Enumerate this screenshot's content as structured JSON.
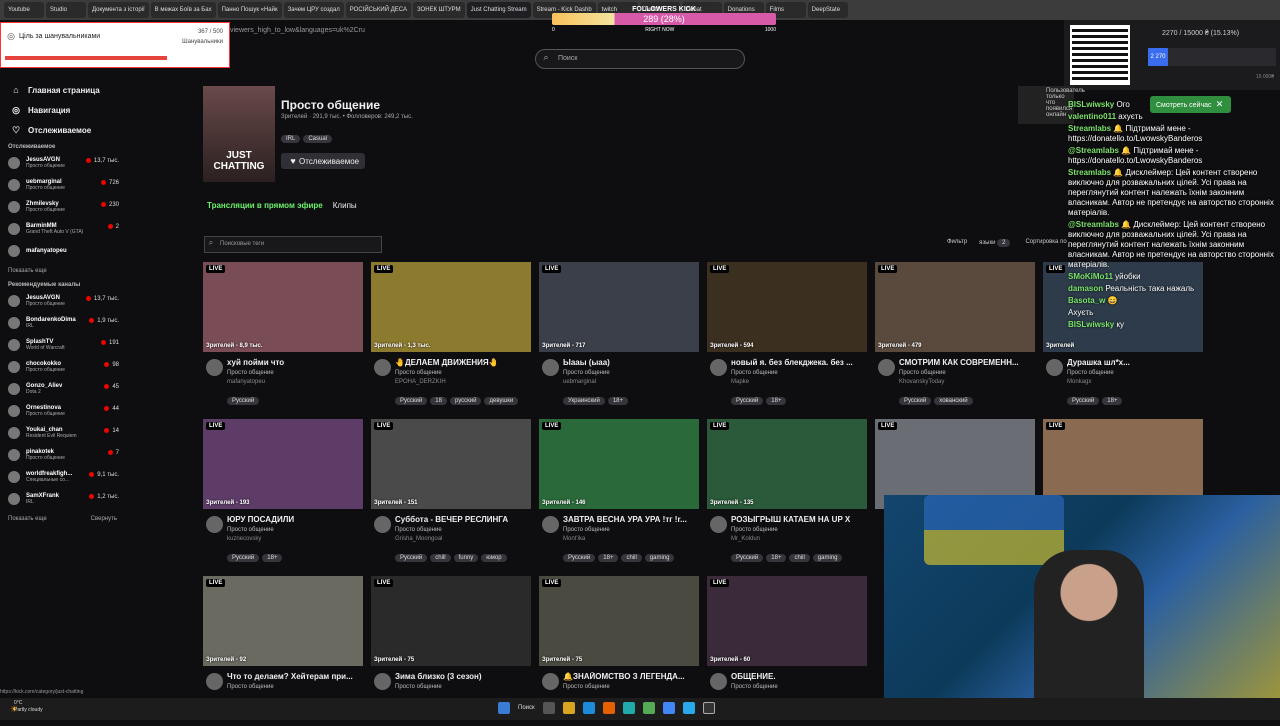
{
  "browser": {
    "tabs": [
      "Youtube",
      "Studio",
      "Документа з історії",
      "В межах Боїв за Бах",
      "Панно Пошук «Найк",
      "Зачем ЦРУ создал",
      "РОСІЙСЬКИЙ ДЕСА",
      "ЗОНЕК ШТУРМ",
      "Just Chatting Stream",
      "Stream - Kick Dashb",
      "twitch",
      "Twitch",
      "Donat",
      "Donations",
      "Films",
      "DeepState"
    ],
    "address": "viewers_high_to_low&languages=uk%2Cru"
  },
  "goal": {
    "title": "Ціль за шанувальниками",
    "count": "367 / 500",
    "sub": "Шанувальники"
  },
  "follower_bar": {
    "title": "FOLLOWERS KICK",
    "value": "289 (28%)",
    "progress_pct": 28,
    "min": "0",
    "mid": "RIGHT NOW",
    "max": "1000"
  },
  "search": {
    "placeholder": "Поиск"
  },
  "nav": [
    {
      "label": "Главная страница",
      "icon": "home-icon"
    },
    {
      "label": "Навигация",
      "icon": "compass-icon"
    },
    {
      "label": "Отслеживаемое",
      "icon": "heart-icon"
    }
  ],
  "followed": {
    "heading": "Отслеживаемое",
    "more": "Показать еще",
    "items": [
      {
        "name": "JesusAVGN",
        "game": "Просто общение",
        "viewers": "13,7 тыс."
      },
      {
        "name": "uebmarginal",
        "game": "Просто общение",
        "viewers": "726"
      },
      {
        "name": "Zhmilevsky",
        "game": "Просто общение",
        "viewers": "230"
      },
      {
        "name": "BarminMM",
        "game": "Grand Theft Auto V (GTA)",
        "viewers": "2"
      },
      {
        "name": "mafanyatopeu",
        "game": "",
        "viewers": ""
      }
    ]
  },
  "recommended": {
    "heading": "Рекомендуемые каналы",
    "more": "Показать еще",
    "collapse": "Свернуть",
    "items": [
      {
        "name": "JesusAVGN",
        "game": "Просто общение",
        "viewers": "13,7 тыс."
      },
      {
        "name": "BondarenkoDima",
        "game": "IRL",
        "viewers": "1,9 тыс."
      },
      {
        "name": "SplashTV",
        "game": "World of Warcraft",
        "viewers": "191"
      },
      {
        "name": "chocokokko",
        "game": "Просто общение",
        "viewers": "98"
      },
      {
        "name": "Gonzo_Aliev",
        "game": "Dota 2",
        "viewers": "45"
      },
      {
        "name": "Ornestinova",
        "game": "Просто общение",
        "viewers": "44"
      },
      {
        "name": "Youkai_chan",
        "game": "Resident Evil Requiem",
        "viewers": "14"
      },
      {
        "name": "pinakotek",
        "game": "Просто общение",
        "viewers": "7"
      },
      {
        "name": "worldfreakfigh...",
        "game": "Специальные со...",
        "viewers": "9,1 тыс."
      },
      {
        "name": "SamXFrank",
        "game": "IRL",
        "viewers": "1,2 тыс."
      }
    ]
  },
  "category": {
    "title": "Просто общение",
    "stats": "Зрителей · 291,9 тыс.  •  Фолловеров: 249,2 тыс.",
    "tags": [
      "IRL",
      "Casual"
    ],
    "follow_label": "Отслеживаемое",
    "cover_text": "JUST CHATTING"
  },
  "tabs": {
    "live": "Трансляции в прямом эфире",
    "clips": "Клипы"
  },
  "tag_search": {
    "placeholder": "Поисковые теги"
  },
  "filters": {
    "filter": "Фильтр",
    "languages": "языки",
    "lang_count": "2",
    "sort": "Сортировка по"
  },
  "streams": [
    {
      "title": "хуй пойми что",
      "channel": "mafanyatopeu",
      "cat": "Просто общение",
      "viewers": "Зрителей - 8,9 тыс.",
      "tags": [
        "Русский"
      ],
      "color": "#7a4c55"
    },
    {
      "title": "🤚ДЕЛАЕМ ДВИЖЕНИЯ🤚",
      "channel": "EPOHA_DERZKIH",
      "cat": "Просто общение",
      "viewers": "Зрителей - 1,3 тыс.",
      "tags": [
        "Русский",
        "18",
        "русский",
        "девушки"
      ],
      "color": "#8c7a2e"
    },
    {
      "title": "Ыааы (ыаа)",
      "channel": "uebmarginal",
      "cat": "Просто общение",
      "viewers": "Зрителей - 717",
      "tags": [
        "Украинский",
        "18+"
      ],
      "color": "#3a3f4a"
    },
    {
      "title": "новый я. без блекджека. без ...",
      "channel": "Mapke",
      "cat": "Просто общение",
      "viewers": "Зрителей - 594",
      "tags": [
        "Русский",
        "18+"
      ],
      "color": "#3b3020"
    },
    {
      "title": "СМОТРИМ КАК СОВРЕМЕНН...",
      "channel": "KhovanskyToday",
      "cat": "Просто общение",
      "viewers": "Зрителей - 479",
      "tags": [
        "Русский",
        "хованский"
      ],
      "color": "#5a4a3e"
    },
    {
      "title": "Дурашка шл*х...",
      "channel": "Monkagx",
      "cat": "Просто общение",
      "viewers": "Зрителей",
      "tags": [
        "Русский",
        "18+"
      ],
      "color": "#2d3b4a"
    },
    {
      "title": "ЮРУ ПОСАДИЛИ",
      "channel": "kuznecovsky",
      "cat": "Просто общение",
      "viewers": "Зрителей - 193",
      "tags": [
        "Русский",
        "18+"
      ],
      "color": "#5e3c68"
    },
    {
      "title": "Суббота - ВЕЧЕР РЕСЛИНГА",
      "channel": "Grisha_Moongoal",
      "cat": "Просто общение",
      "viewers": "Зрителей - 151",
      "tags": [
        "Русский",
        "chill",
        "funny",
        "юмор"
      ],
      "color": "#4a4a4a"
    },
    {
      "title": "ЗАВТРА ВЕСНА УРА УРА !тг !r...",
      "channel": "Mont'ika",
      "cat": "Просто общение",
      "viewers": "Зрителей - 146",
      "tags": [
        "Русский",
        "18+",
        "chill",
        "gaming"
      ],
      "color": "#2a6a3a"
    },
    {
      "title": "РОЗЫГРЫШ КАТАЕМ НА UP X",
      "channel": "Mr_Koldun",
      "cat": "Просто общение",
      "viewers": "Зрителей - 135",
      "tags": [
        "Русский",
        "18+",
        "chill",
        "gaming"
      ],
      "color": "#2a5a3a"
    },
    {
      "title": "",
      "channel": "",
      "cat": "",
      "viewers": "",
      "tags": [],
      "color": "#6a6e74"
    },
    {
      "title": "",
      "channel": "",
      "cat": "",
      "viewers": "",
      "tags": [],
      "color": "#8a6a50"
    },
    {
      "title": "Что то делаем? Хейтерам при...",
      "channel": "",
      "cat": "Просто общение",
      "viewers": "Зрителей - 92",
      "tags": [],
      "color": "#6a6a60"
    },
    {
      "title": "Зима близко (3 сезон)",
      "channel": "",
      "cat": "Просто общение",
      "viewers": "Зрителей - 75",
      "tags": [],
      "color": "#2a2a2a"
    },
    {
      "title": "🔔ЗНАЙОМСТВО З ЛЕГЕНДА...",
      "channel": "",
      "cat": "Просто общение",
      "viewers": "Зрителей - 75",
      "tags": [],
      "color": "#4a4a40"
    },
    {
      "title": "ОБЩЕНИЕ.",
      "channel": "",
      "cat": "Просто общение",
      "viewers": "Зрителей - 60",
      "tags": [],
      "color": "#3a2a3a"
    }
  ],
  "live_label": "LIVE",
  "donation": {
    "progress": "2270 / 15000 ₴ (15.13%)",
    "current": "2 270",
    "end": "15 000₴"
  },
  "popup": {
    "text": "Пользователь только что появился онлайн"
  },
  "watch_button": "Смотреть сейчас",
  "chat": [
    {
      "user": "BISLwiwsky",
      "text": "Ого"
    },
    {
      "user": "valentino011",
      "text": "ахуєть"
    },
    {
      "user": "Streamlabs",
      "text": "🔔 Підтримай мене - https://donatello.to/LwowskyBanderos"
    },
    {
      "user": "@Streamlabs",
      "text": "🔔 Підтримай мене - https://donatello.to/LwowskyBanderos"
    },
    {
      "user": "Streamlabs",
      "text": "🔔 Дисклеймер: Цей контент створено виключно для розважальних цілей. Усі права на переглянутий контент належать їхнім законним власникам. Автор не претендує на авторство сторонніх матеріалів."
    },
    {
      "user": "@Streamlabs",
      "text": "🔔 Дисклеймер: Цей контент створено виключно для розважальних цілей. Усі права на переглянутий контент належать їхнім законним власникам. Автор не претендує на авторство сторонніх матеріалів."
    },
    {
      "user": "SMoKiMo11",
      "text": "уйобки"
    },
    {
      "user": "damason",
      "text": "Реальність така нажаль"
    },
    {
      "user": "Basota_w",
      "text": "😄"
    },
    {
      "user": "",
      "text": "Ахуєть"
    },
    {
      "user": "BISLwiwsky",
      "text": "ку"
    }
  ],
  "statusbar": {
    "url": "https://kick.com/category/just-chatting"
  },
  "taskbar": {
    "weather_temp": "0°C",
    "weather_desc": "Partly cloudy",
    "search": "Поиск"
  }
}
